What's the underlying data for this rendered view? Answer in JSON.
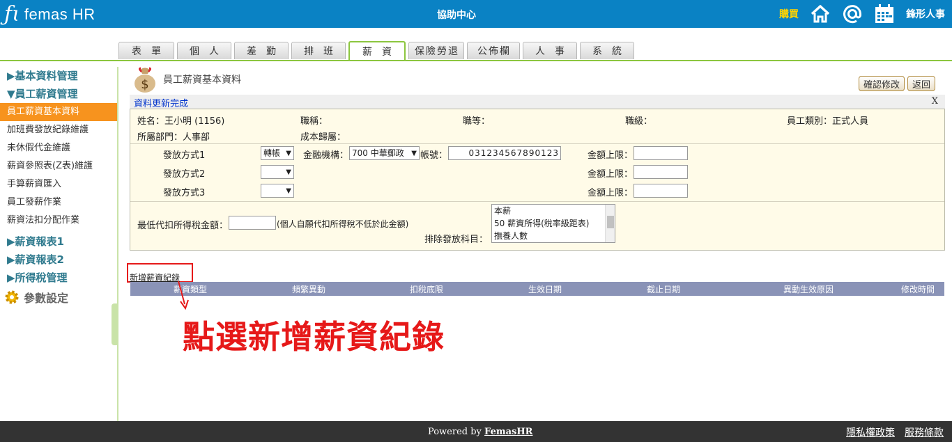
{
  "header": {
    "logo": "femas HR",
    "center_title": "協助中心",
    "buy_label": "購買",
    "user_name": "鋒形人事"
  },
  "tabs": [
    {
      "label": "表單",
      "active": false
    },
    {
      "label": "個人",
      "active": false
    },
    {
      "label": "差勤",
      "active": false
    },
    {
      "label": "排班",
      "active": false
    },
    {
      "label": "薪資",
      "active": true
    },
    {
      "label": "保險勞退",
      "active": false
    },
    {
      "label": "公佈欄",
      "active": false
    },
    {
      "label": "人事",
      "active": false
    },
    {
      "label": "系統",
      "active": false
    }
  ],
  "sidebar": {
    "groups": [
      {
        "label": "▶基本資料管理"
      },
      {
        "label": "▼員工薪資管理"
      }
    ],
    "items": [
      {
        "label": "員工薪資基本資料",
        "active": true
      },
      {
        "label": "加班費發放紀錄維護",
        "active": false
      },
      {
        "label": "未休假代金維護",
        "active": false
      },
      {
        "label": "薪資參照表(Z表)維護",
        "active": false
      },
      {
        "label": "手算薪資匯入",
        "active": false
      },
      {
        "label": "員工發薪作業",
        "active": false
      },
      {
        "label": "薪資法扣分配作業",
        "active": false
      }
    ],
    "groups2": [
      {
        "label": "▶薪資報表1"
      },
      {
        "label": "▶薪資報表2"
      },
      {
        "label": "▶所得稅管理"
      }
    ],
    "param_label": "參數設定"
  },
  "page": {
    "title": "員工薪資基本資料",
    "confirm_button": "確認修改",
    "back_button": "返回",
    "status_text": "資料更新完成",
    "close_label": "X"
  },
  "employee": {
    "name": "姓名：王小明 (1156)",
    "job_title": "職稱：",
    "job_grade": "職等：",
    "job_level": "職級：",
    "emp_type": "員工類別：正式人員",
    "department": "所屬部門：人事部",
    "cost_center": "成本歸屬："
  },
  "payment": {
    "method1_label": "發放方式1",
    "method2_label": "發放方式2",
    "method3_label": "發放方式3",
    "method1_value": "轉帳",
    "bank_label": "金融機構：",
    "bank_value": "700 中華郵政",
    "account_label": "帳號：",
    "account_value": "031234567890123",
    "limit_label": "金額上限："
  },
  "tax": {
    "min_label": "最低代扣所得稅金額：",
    "min_note": "(個人自願代扣所得稅不低於此金額)",
    "exclude_label": "排除發放科目：",
    "exclude_options": [
      "本薪",
      "50 薪資所得(稅率級距表)",
      "撫養人數"
    ]
  },
  "records": {
    "add_link": "新增薪資紀錄",
    "columns": [
      "薪資類型",
      "頻繁異動",
      "扣稅底限",
      "生效日期",
      "截止日期",
      "異動生效原因",
      "修改時間"
    ]
  },
  "annotation": "點選新增薪資紀錄",
  "footer": {
    "powered_prefix": "Powered by",
    "powered_brand": "FemasHR",
    "privacy": "隱私權政策",
    "terms": "服務條款"
  },
  "colors": {
    "header_blue": "#0a82c4",
    "accent_green": "#8cc63f",
    "sidebar_active": "#f7931e",
    "annotation_red": "#e61919",
    "table_header": "#8a93b7"
  }
}
